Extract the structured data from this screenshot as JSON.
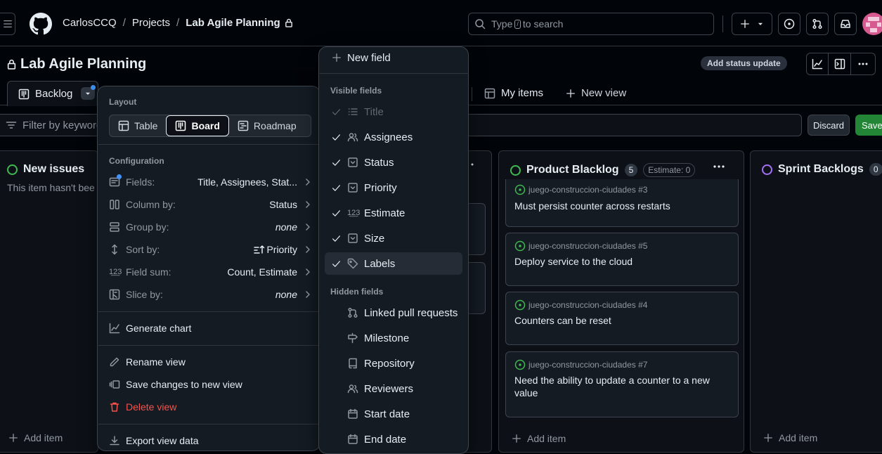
{
  "header": {
    "owner": "CarlosCCQ",
    "projects": "Projects",
    "project": "Lab Agile Planning",
    "search_prefix": "Type",
    "search_key": "/",
    "search_suffix": "to search"
  },
  "project": {
    "title": "Lab Agile Planning",
    "status_update": "Add status update"
  },
  "tabs": {
    "backlog": "Backlog",
    "my_items": "My items",
    "new_view": "New view"
  },
  "filter": {
    "placeholder": "Filter by keyword",
    "discard": "Discard",
    "save": "Save"
  },
  "columns": {
    "new_issues": {
      "name": "New issues",
      "empty": "This item hasn't bee",
      "add": "Add item",
      "color": "#3fb950"
    },
    "product_backlog": {
      "name": "Product Blacklog",
      "count": "5",
      "estimate": "Estimate: 0",
      "add": "Add item",
      "color": "#3fb950",
      "cards": [
        {
          "repo": "juego-construccion-ciudades #3",
          "title": "Must persist counter across restarts"
        },
        {
          "repo": "juego-construccion-ciudades #5",
          "title": "Deploy service to the cloud"
        },
        {
          "repo": "juego-construccion-ciudades #4",
          "title": "Counters can be reset"
        },
        {
          "repo": "juego-construccion-ciudades #7",
          "title": "Need the ability to update a counter to a new value"
        }
      ]
    },
    "sprint_backlogs": {
      "name": "Sprint Backlogs",
      "count": "0",
      "add": "Add item",
      "color": "#a371f7"
    }
  },
  "layout_menu": {
    "layout_label": "Layout",
    "layouts": {
      "table": "Table",
      "board": "Board",
      "roadmap": "Roadmap"
    },
    "active_layout": "Board",
    "configuration_label": "Configuration",
    "config": {
      "fields": {
        "label": "Fields:",
        "value": "Title, Assignees, Stat..."
      },
      "column_by": {
        "label": "Column by:",
        "value": "Status"
      },
      "group_by": {
        "label": "Group by:",
        "value": "none"
      },
      "sort_by": {
        "label": "Sort by:",
        "value": "Priority"
      },
      "field_sum": {
        "label": "Field sum:",
        "value": "Count, Estimate"
      },
      "slice_by": {
        "label": "Slice by:",
        "value": "none"
      }
    },
    "generate_chart": "Generate chart",
    "rename_view": "Rename view",
    "save_changes": "Save changes to new view",
    "delete_view": "Delete view",
    "export": "Export view data"
  },
  "fields_menu": {
    "new_field": "New field",
    "visible_label": "Visible fields",
    "visible": {
      "title": "Title",
      "assignees": "Assignees",
      "status": "Status",
      "priority": "Priority",
      "estimate": "Estimate",
      "size": "Size",
      "labels": "Labels"
    },
    "hidden_label": "Hidden fields",
    "hidden": {
      "linked_prs": "Linked pull requests",
      "milestone": "Milestone",
      "repository": "Repository",
      "reviewers": "Reviewers",
      "start_date": "Start date",
      "end_date": "End date"
    }
  },
  "colors": {
    "background": "#010409",
    "surface": "#151b23",
    "accent_blue": "#4493f8",
    "success_green": "#238636",
    "danger_red": "#f85149"
  }
}
